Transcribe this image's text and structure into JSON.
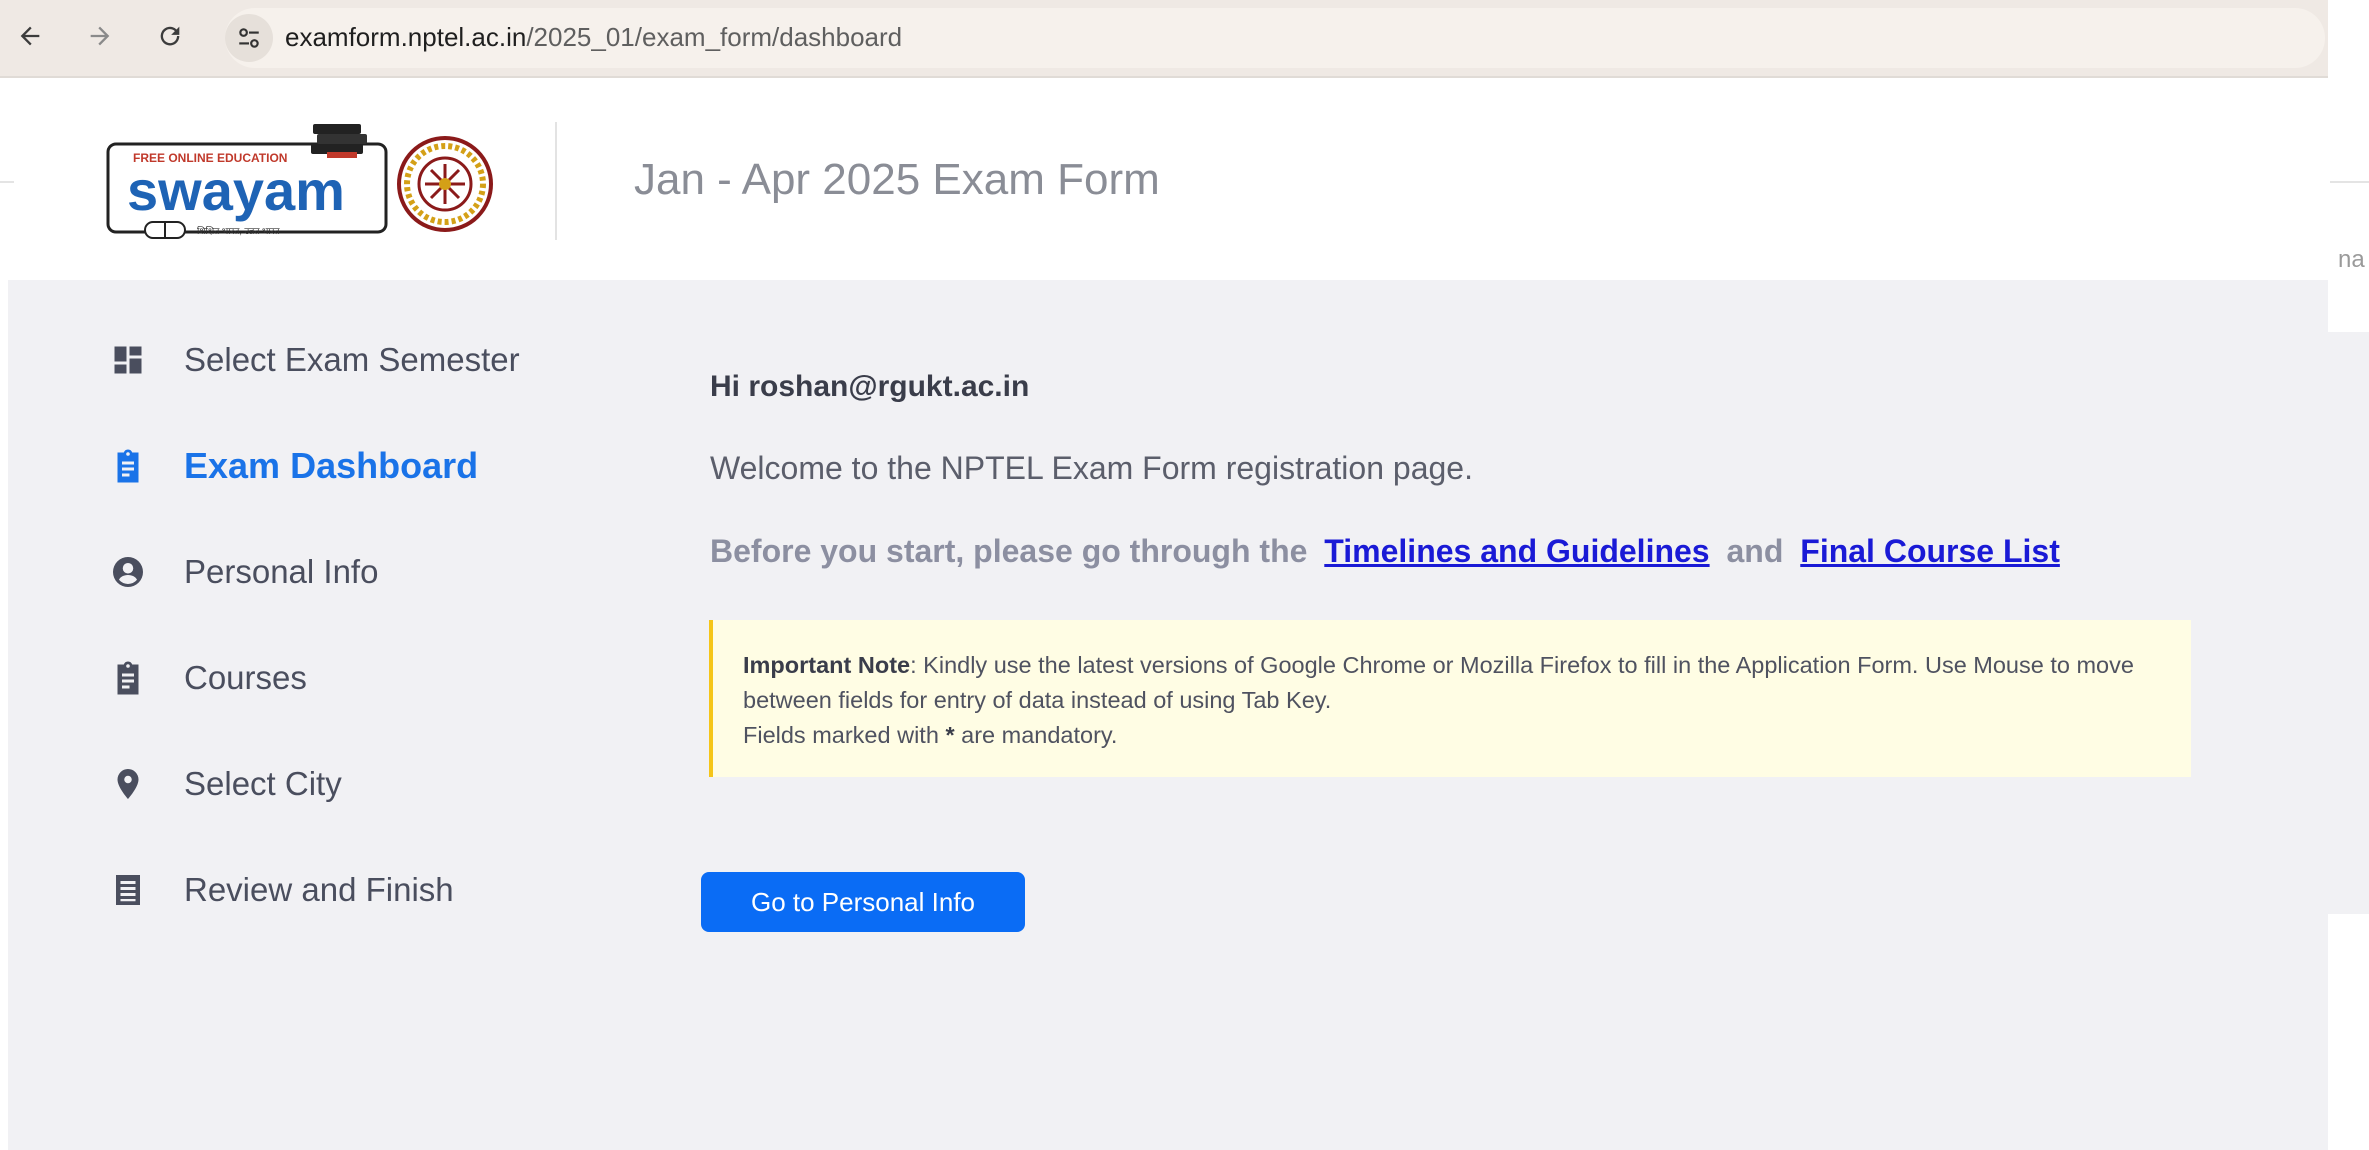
{
  "browser": {
    "url_host": "examform.nptel.ac.in",
    "url_path": "/2025_01/exam_form/dashboard",
    "icons": [
      "back-arrow-icon",
      "forward-arrow-icon",
      "reload-icon",
      "site-info-icon"
    ]
  },
  "header": {
    "logo_text": "swayam",
    "logo_tagline": "FREE ONLINE EDUCATION",
    "title": "Jan - Apr 2025 Exam Form",
    "edge_fragment": "na"
  },
  "sidebar": {
    "items": [
      {
        "label": "Select Exam Semester",
        "icon": "dashboard-icon",
        "active": false
      },
      {
        "label": "Exam Dashboard",
        "icon": "clipboard-icon",
        "active": true
      },
      {
        "label": "Personal Info",
        "icon": "user-circle-icon",
        "active": false
      },
      {
        "label": "Courses",
        "icon": "clipboard-icon",
        "active": false
      },
      {
        "label": "Select City",
        "icon": "location-pin-icon",
        "active": false
      },
      {
        "label": "Review and Finish",
        "icon": "list-icon",
        "active": false
      }
    ]
  },
  "content": {
    "greeting": "Hi roshan@rgukt.ac.in",
    "welcome": "Welcome to the NPTEL Exam Form registration page.",
    "before_text": "Before you start, please go through the",
    "link_timelines": "Timelines and Guidelines",
    "and_text": "and",
    "link_course_list": "Final Course List",
    "note_title": "Important Note",
    "note_body": ": Kindly use the latest versions of Google Chrome or Mozilla Firefox to fill in the Application Form. Use Mouse to move between fields for entry of data instead of using Tab Key.",
    "note_fields_prefix": "Fields marked with",
    "note_star": "*",
    "note_fields_suffix": "are mandatory.",
    "button_label": "Go to Personal Info"
  },
  "colors": {
    "accent": "#1a73e8",
    "button": "#0a6cf5",
    "note_bg": "#fffde4",
    "note_border": "#f5c518",
    "panel_bg": "#f1f1f4"
  }
}
